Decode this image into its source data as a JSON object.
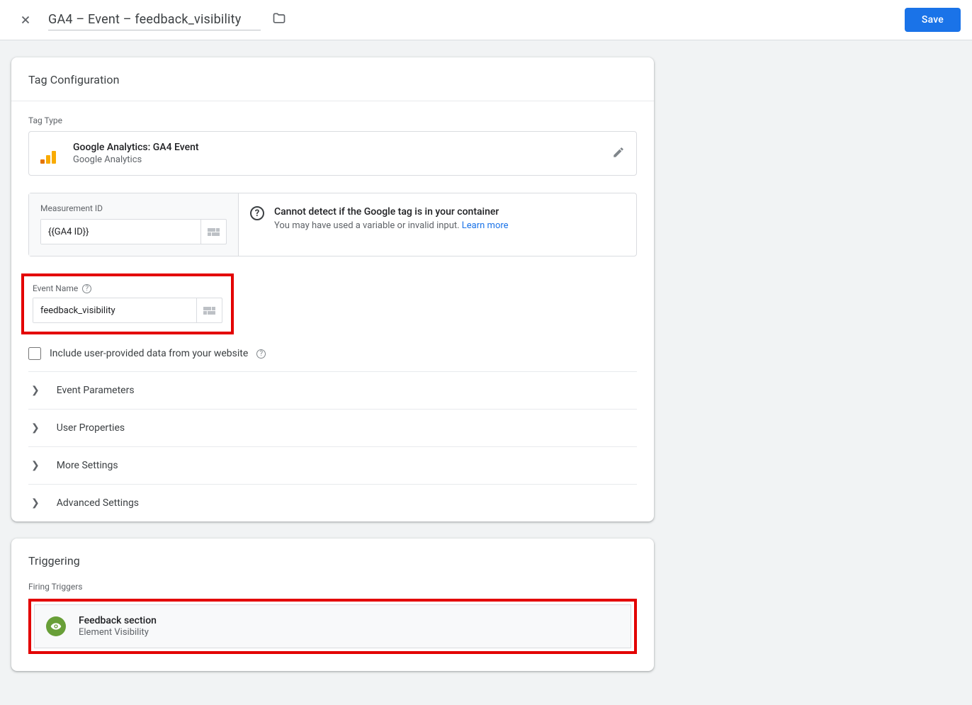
{
  "header": {
    "title": "GA4 – Event – feedback_visibility",
    "save_label": "Save"
  },
  "tagConfig": {
    "section_title": "Tag Configuration",
    "tag_type_label": "Tag Type",
    "tag_type_name": "Google Analytics: GA4 Event",
    "tag_type_provider": "Google Analytics",
    "measurement_label": "Measurement ID",
    "measurement_value": "{{GA4 ID}}",
    "warning_title": "Cannot detect if the Google tag is in your container",
    "warning_body": "You may have used a variable or invalid input. ",
    "learn_more": "Learn more",
    "event_name_label": "Event Name",
    "event_name_value": "feedback_visibility",
    "include_upd_label": "Include user-provided data from your website",
    "expand": {
      "event_params": "Event Parameters",
      "user_props": "User Properties",
      "more_settings": "More Settings",
      "advanced": "Advanced Settings"
    }
  },
  "triggering": {
    "section_title": "Triggering",
    "firing_label": "Firing Triggers",
    "trigger_name": "Feedback section",
    "trigger_type": "Element Visibility"
  }
}
